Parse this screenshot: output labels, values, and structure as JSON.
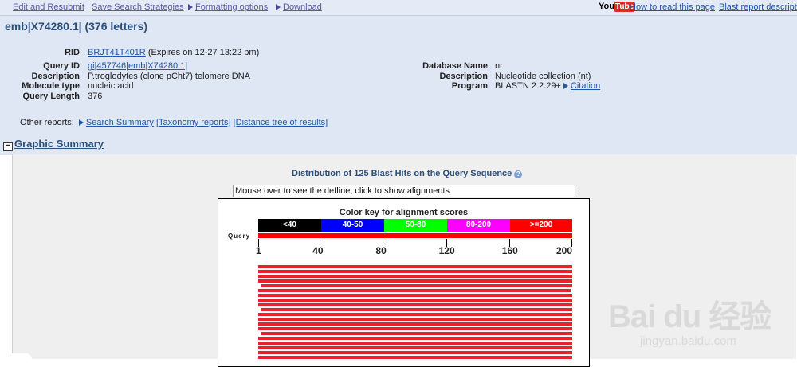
{
  "nav": {
    "edit_resubmit": "Edit and Resubmit",
    "save_strategies": "Save Search Strategies",
    "formatting_options": "Formatting options",
    "download": "Download",
    "youtube_you": "You",
    "youtube_tube": "Tube",
    "how_to_read": "How to read this page",
    "blast_report_desc": "Blast report description"
  },
  "title": "emb|X74280.1| (376 letters)",
  "query": {
    "rid_label": "RID",
    "rid_link": "BRJT41T401R",
    "rid_expires": "(Expires on 12-27 13:22 pm)",
    "query_id_label": "Query ID",
    "query_id": "gi|457746|emb|X74280.1|",
    "description_label": "Description",
    "description": "P.troglodytes (clone pCht7) telomere DNA",
    "molecule_type_label": "Molecule type",
    "molecule_type": "nucleic acid",
    "query_length_label": "Query Length",
    "query_length": "376"
  },
  "database": {
    "db_name_label": "Database Name",
    "db_name": "nr",
    "description_label": "Description",
    "description": "Nucleotide collection (nt)",
    "program_label": "Program",
    "program": "BLASTN 2.2.29+",
    "citation": "Citation"
  },
  "other_reports": {
    "label": "Other reports:",
    "search_summary": "Search Summary",
    "taxonomy": "[Taxonomy reports]",
    "distance_tree": "[Distance tree of results]"
  },
  "graphic_summary": {
    "title": "Graphic Summary",
    "minus_glyph": "−",
    "distribution_title": "Distribution of 125 Blast Hits on the Query Sequence",
    "help_glyph": "?",
    "mouseover_text": "Mouse over to see the defline, click to show alignments",
    "color_key_title": "Color key for alignment scores",
    "color_key": [
      {
        "label": "<40",
        "color": "#000000"
      },
      {
        "label": "40-50",
        "color": "#0000ff"
      },
      {
        "label": "50-80",
        "color": "#00ff00"
      },
      {
        "label": "80-200",
        "color": "#ff00ff"
      },
      {
        "label": ">=200",
        "color": "#ff0000"
      }
    ],
    "query_label": "Query",
    "axis_ticks": [
      "1",
      "40",
      "80",
      "120",
      "160",
      "200"
    ],
    "hit_color": "#e8222c",
    "hits": [
      {
        "start": 1,
        "end": 200
      },
      {
        "start": 1,
        "end": 200
      },
      {
        "start": 1,
        "end": 200
      },
      {
        "start": 1,
        "end": 200
      },
      {
        "start": 3,
        "end": 200
      },
      {
        "start": 1,
        "end": 199
      },
      {
        "start": 1,
        "end": 200
      },
      {
        "start": 1,
        "end": 200
      },
      {
        "start": 1,
        "end": 200
      },
      {
        "start": 3,
        "end": 200
      },
      {
        "start": 1,
        "end": 200
      },
      {
        "start": 1,
        "end": 200
      },
      {
        "start": 1,
        "end": 200
      },
      {
        "start": 1,
        "end": 200
      },
      {
        "start": 3,
        "end": 200
      },
      {
        "start": 1,
        "end": 200
      },
      {
        "start": 1,
        "end": 200
      },
      {
        "start": 1,
        "end": 200
      },
      {
        "start": 1,
        "end": 200
      },
      {
        "start": 1,
        "end": 200
      }
    ]
  },
  "watermark": {
    "main": "Bai du 经验",
    "sub": "jingyan.baidu.com"
  }
}
